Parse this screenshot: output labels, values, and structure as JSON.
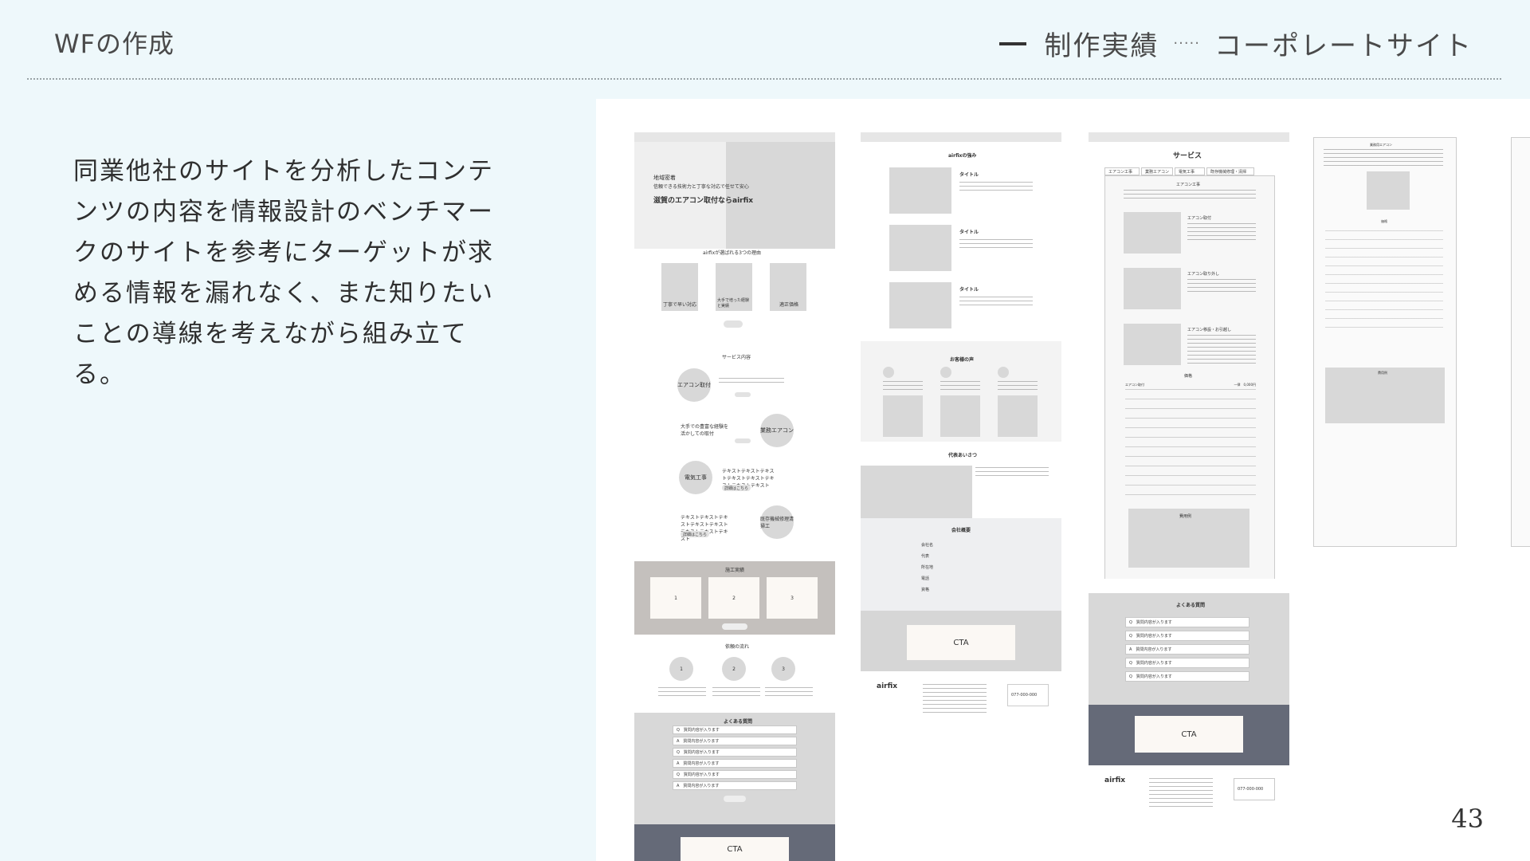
{
  "header": {
    "left_title": "WFの作成",
    "right_category": "制作実績",
    "right_dots": "·····",
    "right_title": "コーポレートサイト"
  },
  "description": "同業他社のサイトを分析したコンテンツの内容を情報設計のベンチマークのサイトを参考にターゲットが求める情報を漏れなく、また知りたいことの導線を考えながら組み立てる。",
  "page_number": "43",
  "wireframes": {
    "brand": "airfix",
    "top": {
      "hero_small1": "地域密着",
      "hero_small2": "信頼できる技術力と丁寧な対応で任せて安心",
      "hero_title": "滋賀のエアコン取付ならairfix",
      "reasons_title": "airfixが選ばれる3つの理由",
      "reason1": "丁寧で早い対応",
      "reason2": "大手で培った経験と実績",
      "reason3": "適正価格",
      "services_title": "サービス内容",
      "service1": "エアコン取付",
      "service2": "業務エアコン",
      "service3": "電気工事",
      "service4": "既存機械修理清掃工",
      "service2_text": "大手での豊富な経験を活かしての取付",
      "service3_text": "テキストテキストテキストテキストテキストテキストテキストテキスト",
      "service4_text": "テキストテキストテキストテキストテキストテキストテキストテキスト",
      "detail_link": "詳細はこちら",
      "works_title": "施工実績",
      "work1": "1",
      "work2": "2",
      "work3": "3",
      "flow_title": "依頼の流れ",
      "flow1": "1",
      "flow2": "2",
      "flow3": "3",
      "faq_title": "よくある質問",
      "faq_q": "Q　質問内容が入ります",
      "faq_a": "A　質問内容が入ります",
      "cta": "CTA"
    },
    "about": {
      "strength_title": "airfixの強み",
      "item_title": "タイトル",
      "voice_title": "お客様の声",
      "greeting_title": "代表あいさつ",
      "company_title": "会社概要",
      "company_rows": [
        "会社名",
        "代表",
        "所在地",
        "電話",
        "資格"
      ],
      "cta": "CTA",
      "phone": "077-000-000"
    },
    "service": {
      "page_title": "サービス",
      "tabs": [
        "エアコン工事",
        "業務エアコン",
        "電気工事",
        "既存機械修理・清掃"
      ],
      "section_title": "エアコン工事",
      "sub1": "エアコン取付",
      "sub2": "エアコン取り外し",
      "sub3": "エアコン移設・お引越し",
      "price_title": "価格",
      "price_item": "エアコン取付",
      "price_value": "一律　0,000円",
      "cost_title": "費用例",
      "faq_title": "よくある質問",
      "cta": "CTA",
      "phone": "077-000-000"
    },
    "service2": {
      "section_title": "業務用エアコン",
      "price_title": "価格",
      "cost_title": "費用例"
    }
  }
}
